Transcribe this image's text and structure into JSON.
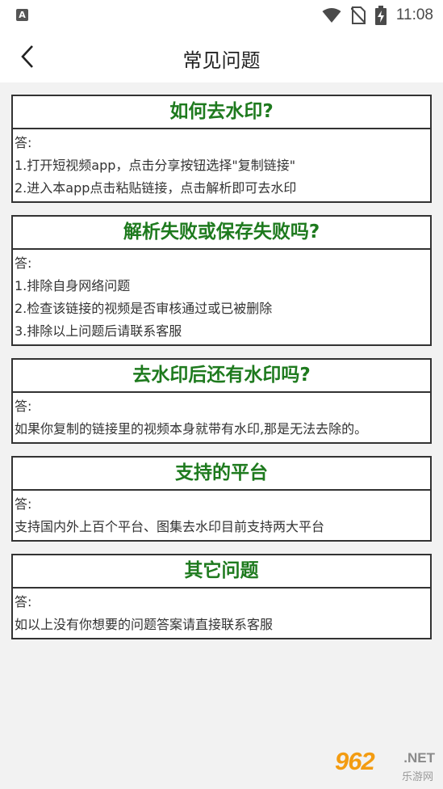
{
  "statusbar": {
    "app_icon_letter": "A",
    "time": "11:08",
    "icons": [
      "wifi-icon",
      "no-sim-icon",
      "battery-charging-icon"
    ]
  },
  "header": {
    "title": "常见问题",
    "back_icon": "chevron-left-icon"
  },
  "faq": [
    {
      "question": "如何去水印?",
      "answer_label": "答:",
      "lines": [
        "1.打开短视频app，点击分享按钮选择\"复制链接\"",
        "2.进入本app点击粘贴链接，点击解析即可去水印"
      ]
    },
    {
      "question": "解析失败或保存失败吗?",
      "answer_label": "答:",
      "lines": [
        "1.排除自身网络问题",
        "2.检查该链接的视频是否审核通过或已被删除",
        "3.排除以上问题后请联系客服"
      ]
    },
    {
      "question": "去水印后还有水印吗?",
      "answer_label": "答:",
      "lines": [
        "如果你复制的链接里的视频本身就带有水印,那是无法去除的。"
      ]
    },
    {
      "question": "支持的平台",
      "answer_label": "答:",
      "lines": [
        "支持国内外上百个平台、图集去水印目前支持两大平台"
      ]
    },
    {
      "question": "其它问题",
      "answer_label": "答:",
      "lines": [
        "如以上没有你想要的问题答案请直接联系客服"
      ]
    }
  ],
  "watermark": {
    "number": "962",
    "net": ".NET",
    "subtitle": "乐游网"
  },
  "colors": {
    "question_text": "#1e7a1e",
    "border": "#333333",
    "background": "#f2f2f2"
  }
}
